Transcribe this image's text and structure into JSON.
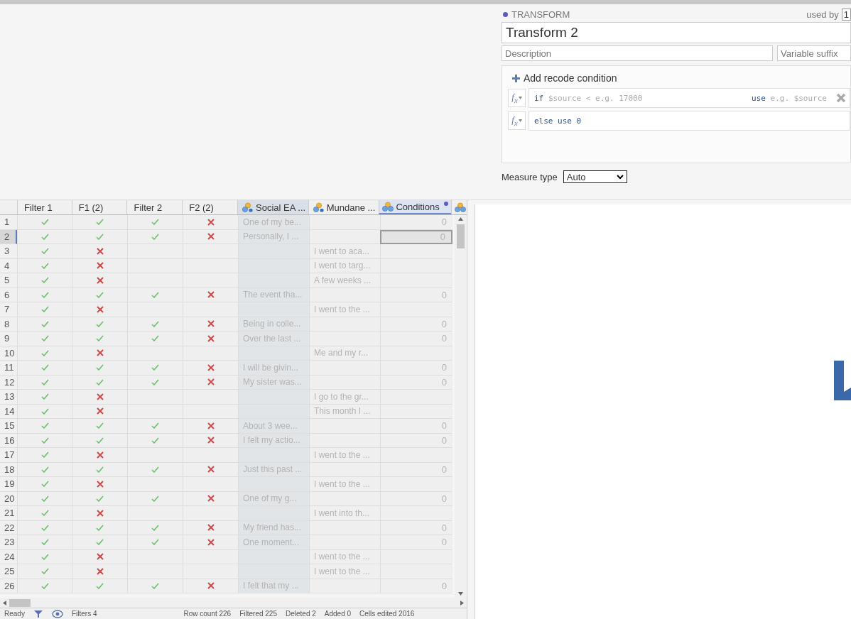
{
  "transform": {
    "heading": "TRANSFORM",
    "used_by_label": "used by",
    "used_by_value": "1",
    "name": "Transform 2",
    "description": {
      "placeholder": "Description"
    },
    "suffix": {
      "placeholder": "Variable suffix"
    },
    "add_label": "Add recode condition",
    "conditions": [
      {
        "kind": "if",
        "button": "f$_{x}$",
        "keyword": "if",
        "source": "$source",
        "operator": "<",
        "value_placeholder": "e.g. 17000",
        "use": "use",
        "use_placeholder": "e.g. $source"
      },
      {
        "kind": "else",
        "button": "f$_{x}$",
        "text": "else use 0"
      }
    ],
    "measure_label": "Measure type",
    "measure_value": "Auto"
  },
  "table": {
    "columns": [
      {
        "label": "Filter 1",
        "kind": "filter",
        "selected": false,
        "highlighted": false
      },
      {
        "label": "F1 (2)",
        "kind": "filter",
        "selected": false,
        "highlighted": false
      },
      {
        "label": "Filter 2",
        "kind": "filter",
        "selected": false,
        "highlighted": false
      },
      {
        "label": "F2 (2)",
        "kind": "filter",
        "selected": false,
        "highlighted": false
      },
      {
        "label": "Social EA ...",
        "kind": "text",
        "selected": false,
        "highlighted": true
      },
      {
        "label": "Mundane ...",
        "kind": "text",
        "selected": false,
        "highlighted": false
      },
      {
        "label": "Conditions",
        "kind": "nominal",
        "selected": true,
        "highlighted": false,
        "edited": true
      },
      {
        "kind": "nominal",
        "selected": false,
        "highlighted": false
      }
    ],
    "rows": [
      {
        "num": "1",
        "selected": false,
        "filter1": true,
        "f1_2": true,
        "filter2": true,
        "f2_2": false,
        "social": "One of my be...",
        "conditions": "0"
      },
      {
        "num": "2",
        "selected": true,
        "filter1": true,
        "f1_2": true,
        "filter2": true,
        "f2_2": false,
        "social": "Personally, I ...",
        "conditions": "0"
      },
      {
        "num": "3",
        "selected": false,
        "filter1": true,
        "f1_2": false,
        "mundane": "I went to aca..."
      },
      {
        "num": "4",
        "selected": false,
        "filter1": true,
        "f1_2": false,
        "mundane": "I went to targ..."
      },
      {
        "num": "5",
        "selected": false,
        "filter1": true,
        "f1_2": false,
        "mundane": "A few weeks ..."
      },
      {
        "num": "6",
        "selected": false,
        "filter1": true,
        "f1_2": true,
        "filter2": true,
        "f2_2": false,
        "social": "The event tha...",
        "conditions": "0"
      },
      {
        "num": "7",
        "selected": false,
        "filter1": true,
        "f1_2": false,
        "mundane": "I went to the ..."
      },
      {
        "num": "8",
        "selected": false,
        "filter1": true,
        "f1_2": true,
        "filter2": true,
        "f2_2": false,
        "social": "Being in colle...",
        "conditions": "0"
      },
      {
        "num": "9",
        "selected": false,
        "filter1": true,
        "f1_2": true,
        "filter2": true,
        "f2_2": false,
        "social": "Over the last ...",
        "conditions": "0"
      },
      {
        "num": "10",
        "selected": false,
        "filter1": true,
        "f1_2": false,
        "mundane": "Me and my r..."
      },
      {
        "num": "11",
        "selected": false,
        "filter1": true,
        "f1_2": true,
        "filter2": true,
        "f2_2": false,
        "social": "I will be givin...",
        "conditions": "0"
      },
      {
        "num": "12",
        "selected": false,
        "filter1": true,
        "f1_2": true,
        "filter2": true,
        "f2_2": false,
        "social": "My sister was...",
        "conditions": "0"
      },
      {
        "num": "13",
        "selected": false,
        "filter1": true,
        "f1_2": false,
        "mundane": "I go to the gr..."
      },
      {
        "num": "14",
        "selected": false,
        "filter1": true,
        "f1_2": false,
        "mundane": "This month I ..."
      },
      {
        "num": "15",
        "selected": false,
        "filter1": true,
        "f1_2": true,
        "filter2": true,
        "f2_2": false,
        "social": "About 3 wee...",
        "conditions": "0"
      },
      {
        "num": "16",
        "selected": false,
        "filter1": true,
        "f1_2": true,
        "filter2": true,
        "f2_2": false,
        "social": "I felt my actio...",
        "conditions": "0"
      },
      {
        "num": "17",
        "selected": false,
        "filter1": true,
        "f1_2": false,
        "mundane": "I went to the ..."
      },
      {
        "num": "18",
        "selected": false,
        "filter1": true,
        "f1_2": true,
        "filter2": true,
        "f2_2": false,
        "social": "Just this past ...",
        "conditions": "0"
      },
      {
        "num": "19",
        "selected": false,
        "filter1": true,
        "f1_2": false,
        "mundane": "I went to the ..."
      },
      {
        "num": "20",
        "selected": false,
        "filter1": true,
        "f1_2": true,
        "filter2": true,
        "f2_2": false,
        "social": "One of my g...",
        "conditions": "0"
      },
      {
        "num": "21",
        "selected": false,
        "filter1": true,
        "f1_2": false,
        "mundane": "I went into th..."
      },
      {
        "num": "22",
        "selected": false,
        "filter1": true,
        "f1_2": true,
        "filter2": true,
        "f2_2": false,
        "social": "My friend has...",
        "conditions": "0"
      },
      {
        "num": "23",
        "selected": false,
        "filter1": true,
        "f1_2": true,
        "filter2": true,
        "f2_2": false,
        "social": "One moment...",
        "conditions": "0"
      },
      {
        "num": "24",
        "selected": false,
        "filter1": true,
        "f1_2": false,
        "mundane": "I went to the ..."
      },
      {
        "num": "25",
        "selected": false,
        "filter1": true,
        "f1_2": false,
        "mundane": "I went to the ..."
      },
      {
        "num": "26",
        "selected": false,
        "filter1": true,
        "f1_2": true,
        "filter2": true,
        "f2_2": false,
        "social": "I felt that my ...",
        "conditions": "0"
      }
    ]
  },
  "status_bar": [
    "Ready",
    "Filters 4",
    "Row count 226",
    "Filtered 225",
    "Deleted 2",
    "Added 0",
    "Cells edited 2016"
  ]
}
